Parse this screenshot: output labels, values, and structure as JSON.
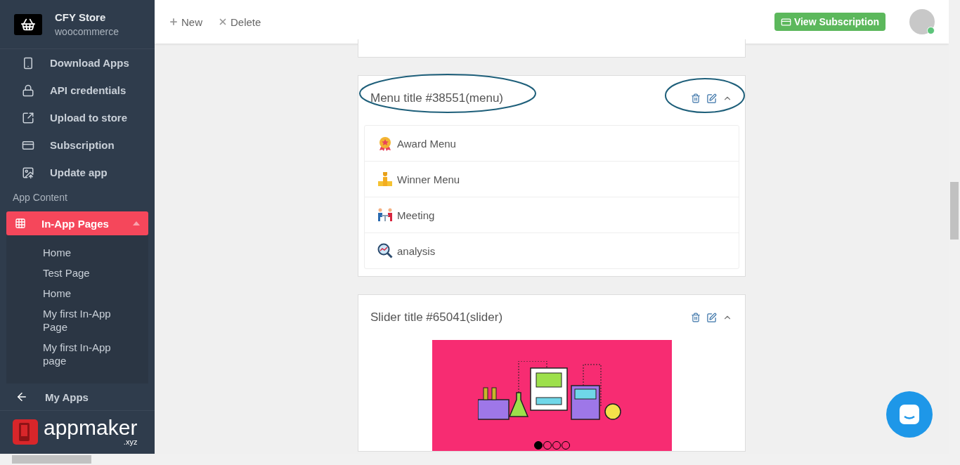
{
  "store": {
    "name": "CFY Store",
    "platform": "woocommerce"
  },
  "sidebar": {
    "items": [
      {
        "label": "Download Apps"
      },
      {
        "label": "API credentials"
      },
      {
        "label": "Upload to store"
      },
      {
        "label": "Subscription"
      },
      {
        "label": "Update app"
      }
    ],
    "section_label": "App Content",
    "active_group": {
      "label": "In-App Pages",
      "selected": true,
      "expanded": true,
      "children": [
        {
          "label": "Home"
        },
        {
          "label": "Test Page"
        },
        {
          "label": "Home"
        },
        {
          "label": "My first In-App Page"
        },
        {
          "label": "My first In-App page"
        }
      ]
    },
    "back_link": "My Apps",
    "logo": {
      "name": "appmaker",
      "suffix": ".xyz"
    }
  },
  "toolbar": {
    "actions": [
      {
        "label": "New"
      },
      {
        "label": "Delete"
      }
    ],
    "subscription_button": "View Subscription",
    "user_online": true
  },
  "cards": [
    {
      "kind": "menu",
      "title": "Menu title #38551(menu)",
      "highlighted": true,
      "items": [
        {
          "label": "Award Menu"
        },
        {
          "label": "Winner Menu"
        },
        {
          "label": "Meeting"
        },
        {
          "label": "analysis"
        }
      ]
    },
    {
      "kind": "slider",
      "title": "Slider title #65041(slider)",
      "highlighted": false,
      "slides": [
        {
          "selected": true
        },
        {
          "selected": false
        },
        {
          "selected": false
        },
        {
          "selected": false
        }
      ]
    }
  ]
}
